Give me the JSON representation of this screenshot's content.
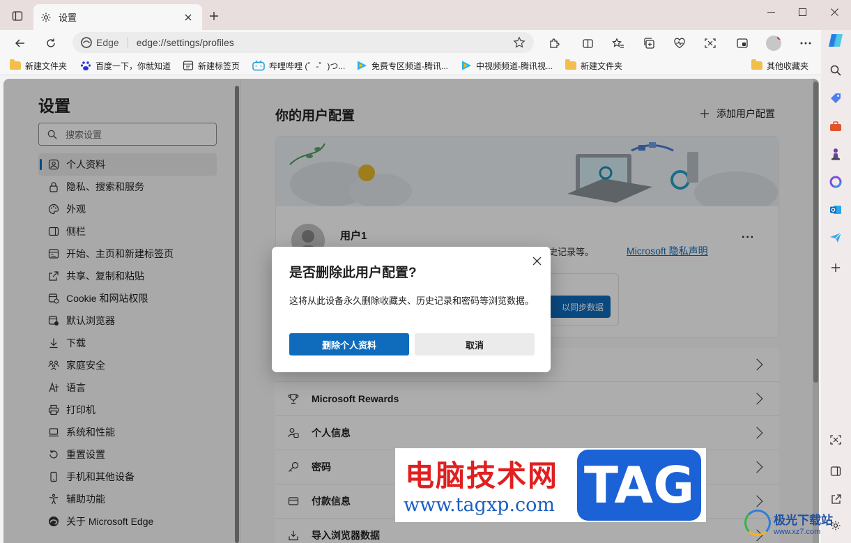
{
  "tab": {
    "title": "设置"
  },
  "address": {
    "site_label": "Edge",
    "url": "edge://settings/profiles"
  },
  "bookmarks": [
    {
      "label": "新建文件夹",
      "icon": "folder-icon"
    },
    {
      "label": "百度一下，你就知道",
      "icon": "baidu-icon"
    },
    {
      "label": "新建标签页",
      "icon": "newtab-icon"
    },
    {
      "label": "哔哩哔哩 (゜-゜)つ...",
      "icon": "bilibili-icon"
    },
    {
      "label": "免费专区频道-腾讯...",
      "icon": "tencent-video-icon"
    },
    {
      "label": "中视频频道-腾讯视...",
      "icon": "tencent-video-icon"
    },
    {
      "label": "新建文件夹",
      "icon": "folder-icon"
    }
  ],
  "bookmarks_other": "其他收藏夹",
  "settings": {
    "title": "设置",
    "search_placeholder": "搜索设置",
    "nav": [
      "个人资料",
      "隐私、搜索和服务",
      "外观",
      "侧栏",
      "开始、主页和新建标签页",
      "共享、复制和粘贴",
      "Cookie 和网站权限",
      "默认浏览器",
      "下载",
      "家庭安全",
      "语言",
      "打印机",
      "系统和性能",
      "重置设置",
      "手机和其他设备",
      "辅助功能",
      "关于 Microsoft Edge"
    ]
  },
  "profiles": {
    "title": "你的用户配置",
    "add_label": "添加用户配置",
    "user_name": "用户1",
    "user_desc": "备份浏览数据，在所有设备上查看收藏夹、密码、历史记录等。",
    "privacy_link": "Microsoft 隐私声明",
    "more": "···",
    "sync_button": "以同步数据"
  },
  "list": [
    {
      "label": "",
      "icon": "sync-icon"
    },
    {
      "label": "Microsoft Rewards",
      "icon": "trophy-icon"
    },
    {
      "label": "个人信息",
      "icon": "person-info-icon"
    },
    {
      "label": "密码",
      "icon": "key-icon"
    },
    {
      "label": "付款信息",
      "icon": "card-icon"
    },
    {
      "label": "导入浏览器数据",
      "icon": "import-icon"
    }
  ],
  "dialog": {
    "title": "是否删除此用户配置?",
    "message": "这将从此设备永久删除收藏夹、历史记录和密码等浏览数据。",
    "confirm": "删除个人资料",
    "cancel": "取消"
  },
  "watermark": {
    "line1": "电脑技术网",
    "line2": "www.tagxp.com",
    "tag": "TAG",
    "corner1": "极光下载站",
    "corner2": "www.xz7.com"
  },
  "colors": {
    "accent": "#0f6cbd",
    "titlebar": "#e8dede",
    "watermark_red": "#e02020",
    "watermark_blue": "#1a62d6"
  }
}
